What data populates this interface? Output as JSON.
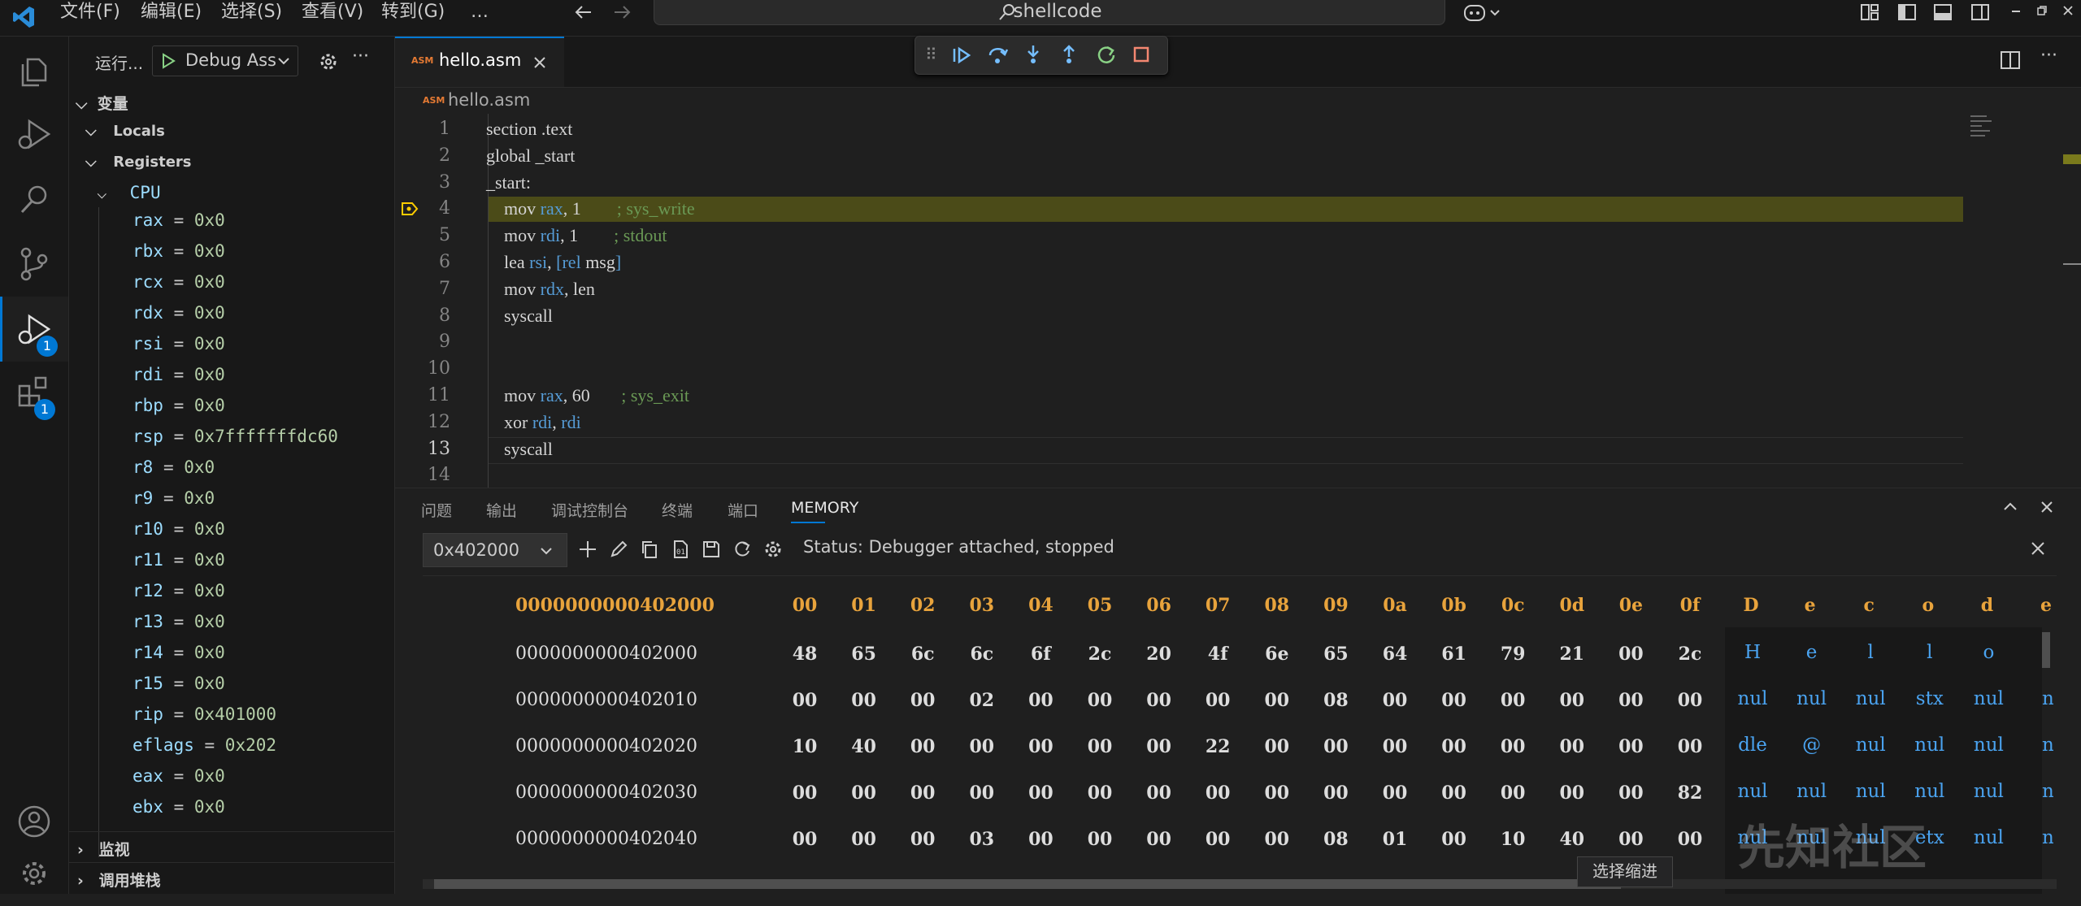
{
  "menu": [
    "文件(F)",
    "编辑(E)",
    "选择(S)",
    "查看(V)",
    "转到(G)",
    "…"
  ],
  "search": {
    "text": "shellcode"
  },
  "activity_badges": {
    "debug": "1",
    "extensions": "1"
  },
  "sidebar": {
    "run_label": "运行...",
    "config": "Debug Ass",
    "variables_title": "变量",
    "locals": "Locals",
    "registers": "Registers",
    "cpu": "CPU",
    "regs": [
      {
        "name": "rax",
        "value": "0x0"
      },
      {
        "name": "rbx",
        "value": "0x0"
      },
      {
        "name": "rcx",
        "value": "0x0"
      },
      {
        "name": "rdx",
        "value": "0x0"
      },
      {
        "name": "rsi",
        "value": "0x0"
      },
      {
        "name": "rdi",
        "value": "0x0"
      },
      {
        "name": "rbp",
        "value": "0x0"
      },
      {
        "name": "rsp",
        "value": "0x7fffffffdc60"
      },
      {
        "name": "r8",
        "value": "0x0"
      },
      {
        "name": "r9",
        "value": "0x0"
      },
      {
        "name": "r10",
        "value": "0x0"
      },
      {
        "name": "r11",
        "value": "0x0"
      },
      {
        "name": "r12",
        "value": "0x0"
      },
      {
        "name": "r13",
        "value": "0x0"
      },
      {
        "name": "r14",
        "value": "0x0"
      },
      {
        "name": "r15",
        "value": "0x0"
      },
      {
        "name": "rip",
        "value": "0x401000"
      },
      {
        "name": "eflags",
        "value": "0x202"
      },
      {
        "name": "eax",
        "value": "0x0"
      },
      {
        "name": "ebx",
        "value": "0x0"
      }
    ],
    "watch": "监视",
    "callstack": "调用堆栈"
  },
  "editor": {
    "tab_icon": "ASM",
    "tab_label": "hello.asm",
    "breadcrumb": "hello.asm",
    "lines": [
      {
        "n": "1",
        "parts": [
          [
            "section .text",
            ""
          ]
        ]
      },
      {
        "n": "2",
        "parts": [
          [
            "global _start",
            ""
          ]
        ]
      },
      {
        "n": "3",
        "parts": [
          [
            "_start:",
            ""
          ]
        ]
      },
      {
        "n": "4",
        "parts": [
          [
            "    mov ",
            ""
          ],
          [
            "rax",
            "kw"
          ],
          [
            ", 1        ",
            ""
          ],
          [
            "; sys_write",
            "cm"
          ]
        ]
      },
      {
        "n": "5",
        "parts": [
          [
            "    mov ",
            ""
          ],
          [
            "rdi",
            "kw"
          ],
          [
            ", 1        ",
            ""
          ],
          [
            "; stdout",
            "cm"
          ]
        ]
      },
      {
        "n": "6",
        "parts": [
          [
            "    lea ",
            ""
          ],
          [
            "rsi",
            "kw"
          ],
          [
            ", ",
            ""
          ],
          [
            "[rel",
            "kw"
          ],
          [
            " msg",
            ""
          ],
          [
            "]",
            "kw"
          ]
        ]
      },
      {
        "n": "7",
        "parts": [
          [
            "    mov ",
            ""
          ],
          [
            "rdx",
            "kw"
          ],
          [
            ", len",
            ""
          ]
        ]
      },
      {
        "n": "8",
        "parts": [
          [
            "    syscall",
            ""
          ]
        ]
      },
      {
        "n": "9",
        "parts": [
          [
            "",
            ""
          ]
        ]
      },
      {
        "n": "10",
        "parts": [
          [
            "",
            ""
          ]
        ]
      },
      {
        "n": "11",
        "parts": [
          [
            "    mov ",
            ""
          ],
          [
            "rax",
            "kw"
          ],
          [
            ", 60       ",
            ""
          ],
          [
            "; sys_exit",
            "cm"
          ]
        ]
      },
      {
        "n": "12",
        "parts": [
          [
            "    xor ",
            ""
          ],
          [
            "rdi",
            "kw"
          ],
          [
            ", ",
            ""
          ],
          [
            "rdi",
            "kw"
          ]
        ]
      },
      {
        "n": "13",
        "parts": [
          [
            "    syscall",
            ""
          ]
        ]
      },
      {
        "n": "14",
        "parts": [
          [
            "",
            ""
          ]
        ]
      }
    ]
  },
  "panel": {
    "tabs": [
      "问题",
      "输出",
      "调试控制台",
      "终端",
      "端口",
      "MEMORY"
    ],
    "address": "0x402000",
    "status": "Status: Debugger attached, stopped",
    "tooltip": "选择缩进",
    "header_addr": "0000000000402000",
    "header_cols": [
      "00",
      "01",
      "02",
      "03",
      "04",
      "05",
      "06",
      "07",
      "08",
      "09",
      "0a",
      "0b",
      "0c",
      "0d",
      "0e",
      "0f"
    ],
    "header_decoded": [
      "D",
      "e",
      "c",
      "o",
      "d",
      "e"
    ],
    "rows": [
      {
        "addr": "0000000000402000",
        "bytes": [
          "48",
          "65",
          "6c",
          "6c",
          "6f",
          "2c",
          "20",
          "4f",
          "6e",
          "65",
          "64",
          "61",
          "79",
          "21",
          "00",
          "2c"
        ],
        "ascii": [
          "H",
          "e",
          "l",
          "l",
          "o",
          ""
        ]
      },
      {
        "addr": "0000000000402010",
        "bytes": [
          "00",
          "00",
          "00",
          "02",
          "00",
          "00",
          "00",
          "00",
          "00",
          "08",
          "00",
          "00",
          "00",
          "00",
          "00",
          "00"
        ],
        "ascii": [
          "nul",
          "nul",
          "nul",
          "stx",
          "nul",
          "n"
        ]
      },
      {
        "addr": "0000000000402020",
        "bytes": [
          "10",
          "40",
          "00",
          "00",
          "00",
          "00",
          "00",
          "22",
          "00",
          "00",
          "00",
          "00",
          "00",
          "00",
          "00",
          "00"
        ],
        "ascii": [
          "dle",
          "@",
          "nul",
          "nul",
          "nul",
          "n"
        ]
      },
      {
        "addr": "0000000000402030",
        "bytes": [
          "00",
          "00",
          "00",
          "00",
          "00",
          "00",
          "00",
          "00",
          "00",
          "00",
          "00",
          "00",
          "00",
          "00",
          "00",
          "82"
        ],
        "ascii": [
          "nul",
          "nul",
          "nul",
          "nul",
          "nul",
          "n"
        ]
      },
      {
        "addr": "0000000000402040",
        "bytes": [
          "00",
          "00",
          "00",
          "03",
          "00",
          "00",
          "00",
          "00",
          "00",
          "08",
          "01",
          "00",
          "10",
          "40",
          "00",
          "00"
        ],
        "ascii": [
          "nul",
          "nul",
          "nul",
          "etx",
          "nul",
          "n"
        ]
      }
    ]
  },
  "watermark": "先知社区",
  "colors": {
    "accent": "#0078d4",
    "highlight": "#4b4b18",
    "memHeader": "#e8a33c",
    "asciiBlue": "#4aa3f0"
  }
}
